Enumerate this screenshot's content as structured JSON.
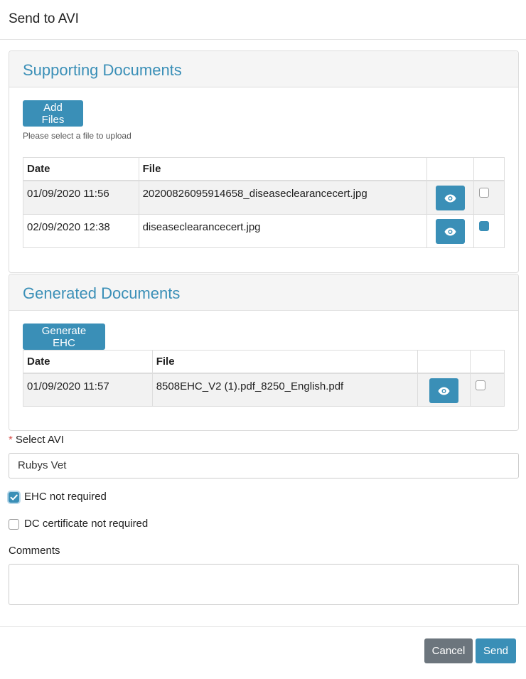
{
  "modal": {
    "title": "Send to AVI"
  },
  "supporting": {
    "title": "Supporting Documents",
    "add_files_label": "Add Files",
    "help_text": "Please select a file to upload",
    "columns": {
      "date": "Date",
      "file": "File"
    },
    "rows": [
      {
        "date": "01/09/2020 11:56",
        "file": "20200826095914658_diseaseclearancecert.jpg",
        "checked": false
      },
      {
        "date": "02/09/2020 12:38",
        "file": "diseaseclearancecert.jpg",
        "checked": true
      }
    ]
  },
  "generated": {
    "title": "Generated Documents",
    "generate_label": "Generate EHC",
    "columns": {
      "date": "Date",
      "file": "File"
    },
    "rows": [
      {
        "date": "01/09/2020 11:57",
        "file": "8508EHC_V2 (1).pdf_8250_English.pdf",
        "checked": false
      }
    ]
  },
  "form": {
    "required_mark": "*",
    "select_avi_label": "Select AVI",
    "select_avi_value": "Rubys Vet",
    "ehc_not_required_label": "EHC not required",
    "ehc_not_required_checked": true,
    "dc_not_required_label": "DC certificate not required",
    "dc_not_required_checked": false,
    "comments_label": "Comments",
    "comments_value": ""
  },
  "footer": {
    "cancel_label": "Cancel",
    "send_label": "Send"
  },
  "icons": {
    "view": "eye-icon",
    "check": "check-icon"
  },
  "colors": {
    "accent": "#3a8fb7",
    "cancel": "#6c757d",
    "required": "#d9534f"
  }
}
